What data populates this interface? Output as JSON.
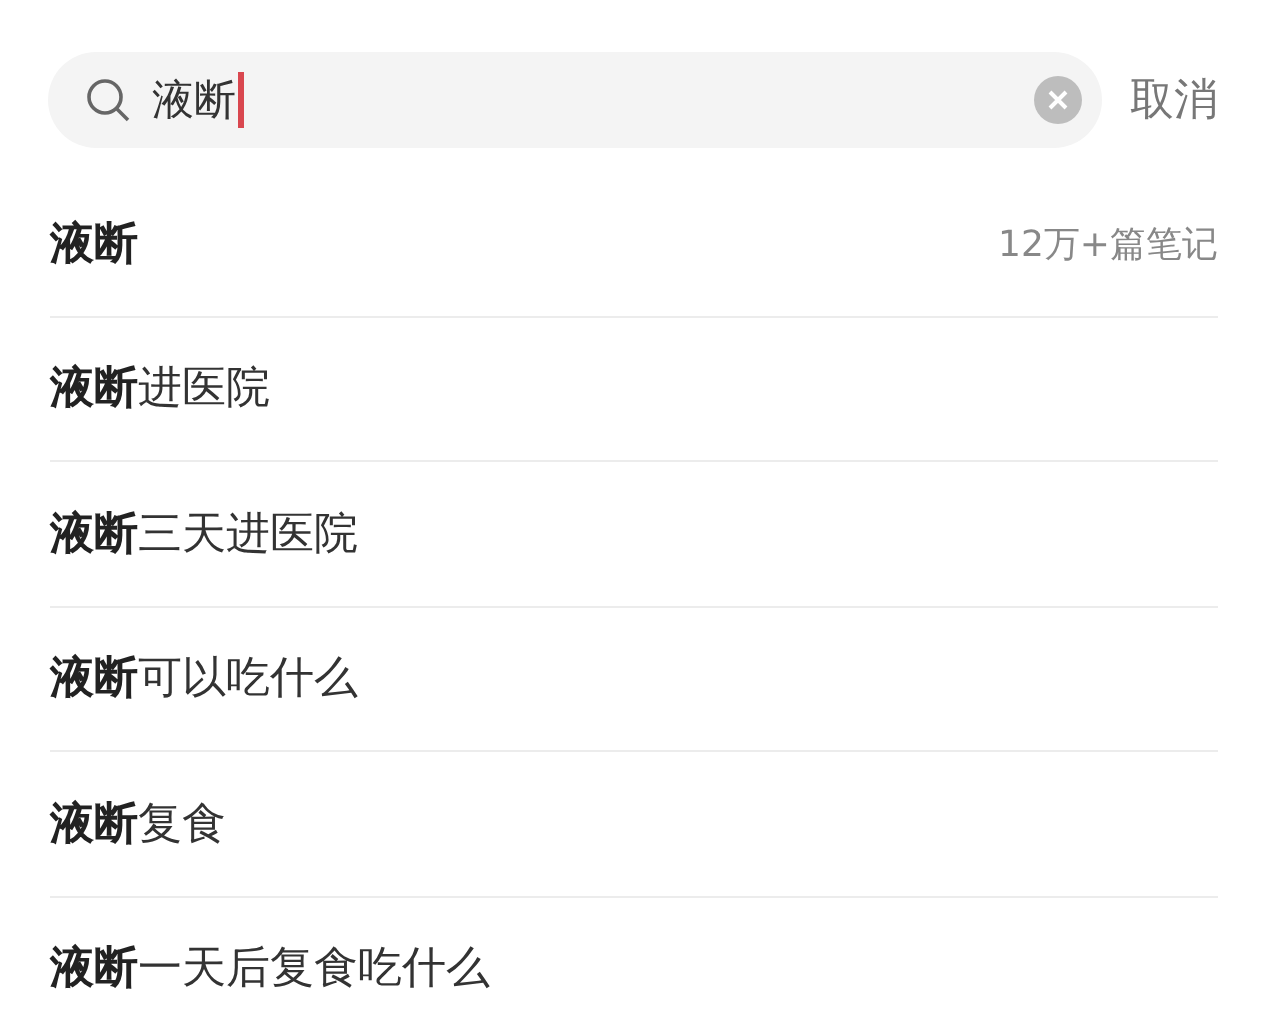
{
  "search": {
    "value": "液断",
    "focused": true,
    "clear_visible": true
  },
  "cancel": "取消",
  "suggestions": [
    {
      "text": "**液断**",
      "count": "12万+篇笔记"
    },
    {
      "text": "**液断**进医院"
    },
    {
      "text": "**液断**三天进医院"
    },
    {
      "text": "**液断**可以吃什么"
    },
    {
      "text": "**液断**复食"
    },
    {
      "text": "**液断**一天后复食吃什么"
    }
  ]
}
